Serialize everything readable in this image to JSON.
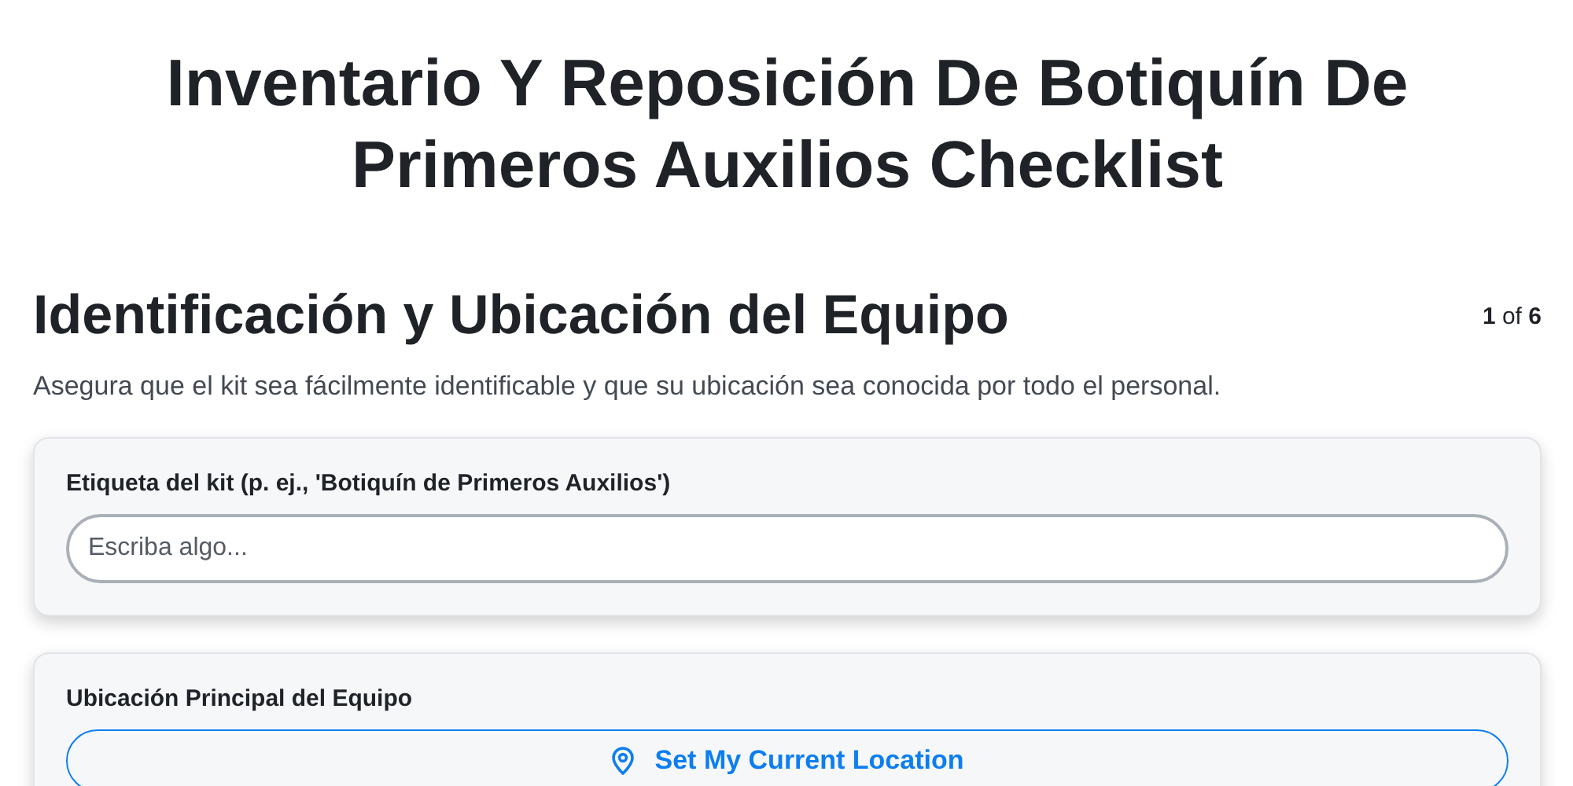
{
  "title": "Inventario Y Reposición De Botiquín De Primeros Auxilios Checklist",
  "section": {
    "heading": "Identificación y Ubicación del Equipo",
    "counter": "**1** of **6**",
    "description": "Asegura que el kit sea fácilmente identificable y que su ubicación sea conocida por todo el personal."
  },
  "questions": [
    {
      "kind": "text",
      "label": "Etiqueta del kit (p. ej., 'Botiquín de Primeros Auxilios')",
      "placeholder": "Escriba algo..."
    },
    {
      "kind": "location",
      "label": "Ubicación Principal del Equipo",
      "button": "Set My Current Location"
    }
  ]
}
